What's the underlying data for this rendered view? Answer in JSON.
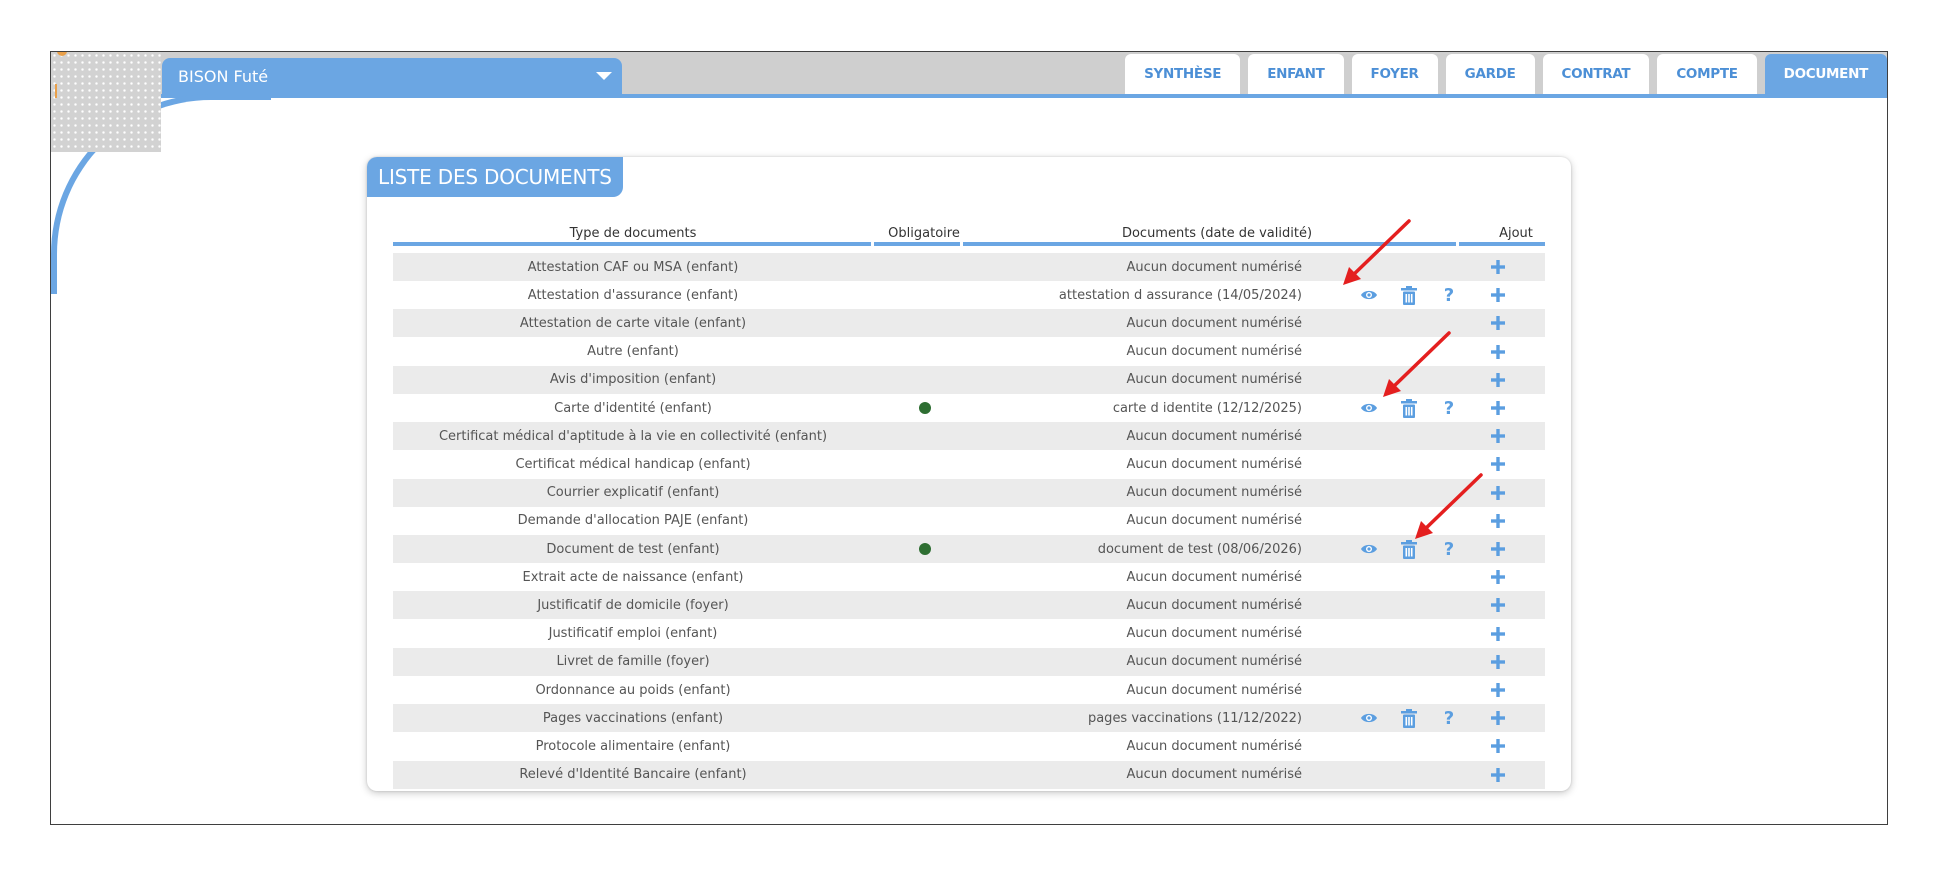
{
  "header": {
    "profile_name": "BISON Futé",
    "tabs": [
      {
        "label": "SYNTHÈSE",
        "active": false
      },
      {
        "label": "ENFANT",
        "active": false
      },
      {
        "label": "FOYER",
        "active": false
      },
      {
        "label": "GARDE",
        "active": false
      },
      {
        "label": "CONTRAT",
        "active": false
      },
      {
        "label": "COMPTE",
        "active": false
      },
      {
        "label": "DOCUMENT",
        "active": true
      }
    ]
  },
  "panel": {
    "title": "LISTE DES DOCUMENTS",
    "columns": {
      "type": "Type de documents",
      "mandatory": "Obligatoire",
      "documents": "Documents (date de validité)",
      "add": "Ajout"
    },
    "rows": [
      {
        "type": "Attestation CAF ou MSA (enfant)",
        "mandatory": false,
        "document": "Aucun document  numérisé",
        "has_document": false
      },
      {
        "type": "Attestation d'assurance (enfant)",
        "mandatory": false,
        "document": "attestation d assurance (14/05/2024)",
        "has_document": true
      },
      {
        "type": "Attestation de carte vitale (enfant)",
        "mandatory": false,
        "document": "Aucun document  numérisé",
        "has_document": false
      },
      {
        "type": "Autre (enfant)",
        "mandatory": false,
        "document": "Aucun document  numérisé",
        "has_document": false
      },
      {
        "type": "Avis d'imposition (enfant)",
        "mandatory": false,
        "document": "Aucun document  numérisé",
        "has_document": false
      },
      {
        "type": "Carte d'identité (enfant)",
        "mandatory": true,
        "document": "carte d identite (12/12/2025)",
        "has_document": true
      },
      {
        "type": "Certificat médical d'aptitude à la vie en collectivité (enfant)",
        "mandatory": false,
        "document": "Aucun document  numérisé",
        "has_document": false
      },
      {
        "type": "Certificat médical handicap (enfant)",
        "mandatory": false,
        "document": "Aucun document  numérisé",
        "has_document": false
      },
      {
        "type": "Courrier explicatif (enfant)",
        "mandatory": false,
        "document": "Aucun document  numérisé",
        "has_document": false
      },
      {
        "type": "Demande d'allocation PAJE (enfant)",
        "mandatory": false,
        "document": "Aucun document  numérisé",
        "has_document": false
      },
      {
        "type": "Document de test (enfant)",
        "mandatory": true,
        "document": "document de test  (08/06/2026)",
        "has_document": true
      },
      {
        "type": "Extrait acte de naissance (enfant)",
        "mandatory": false,
        "document": "Aucun document  numérisé",
        "has_document": false
      },
      {
        "type": "Justificatif de domicile (foyer)",
        "mandatory": false,
        "document": "Aucun document  numérisé",
        "has_document": false
      },
      {
        "type": "Justificatif emploi (enfant)",
        "mandatory": false,
        "document": "Aucun document  numérisé",
        "has_document": false
      },
      {
        "type": "Livret de famille (foyer)",
        "mandatory": false,
        "document": "Aucun document  numérisé",
        "has_document": false
      },
      {
        "type": "Ordonnance au poids (enfant)",
        "mandatory": false,
        "document": "Aucun document  numérisé",
        "has_document": false
      },
      {
        "type": "Pages vaccinations (enfant)",
        "mandatory": false,
        "document": "pages vaccinations  (11/12/2022)",
        "has_document": true
      },
      {
        "type": "Protocole alimentaire (enfant)",
        "mandatory": false,
        "document": "Aucun document  numérisé",
        "has_document": false
      },
      {
        "type": "Relevé d'Identité Bancaire (enfant)",
        "mandatory": false,
        "document": "Aucun document  numérisé",
        "has_document": false
      }
    ]
  },
  "icons": {
    "view": "eye-icon",
    "delete": "trash-icon",
    "help": "question-mark-icon",
    "add": "plus-icon",
    "mandatory": "green-dot-icon",
    "annotation": "red-arrow"
  },
  "colors": {
    "accent": "#6ba6e3",
    "tab_text": "#4c8fd6",
    "mandatory_dot": "#2e6e32",
    "row_alt": "#ebebeb",
    "annotation_arrow": "#e41f1f"
  }
}
